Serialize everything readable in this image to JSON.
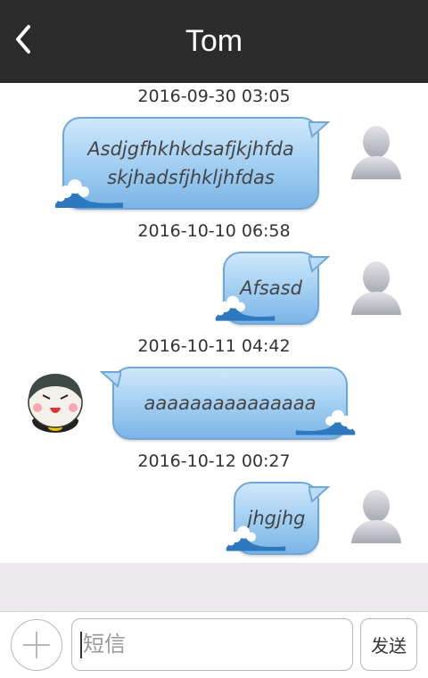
{
  "header": {
    "title": "Tom",
    "back_icon": "chevron-left-icon"
  },
  "messages": [
    {
      "time": "2016-09-30 03:05",
      "side": "right",
      "text_line1": "Asdjgfhkhkdsafjkjhfda",
      "text_line2": "skjhadsfjhkljhfdas"
    },
    {
      "time": "2016-10-10 06:58",
      "side": "right",
      "text": "Afsasd"
    },
    {
      "time": "2016-10-11 04:42",
      "side": "left",
      "text": "aaaaaaaaaaaaaaa"
    },
    {
      "time": "2016-10-12 00:27",
      "side": "right",
      "text": "jhgjhg"
    }
  ],
  "input": {
    "placeholder": "短信",
    "send_label": "发送",
    "plus_icon": "plus-icon"
  },
  "colors": {
    "header_bg": "#2b2b2b",
    "bubble_light": "#cfe8fb",
    "bubble_dark": "#7cb5e6"
  }
}
